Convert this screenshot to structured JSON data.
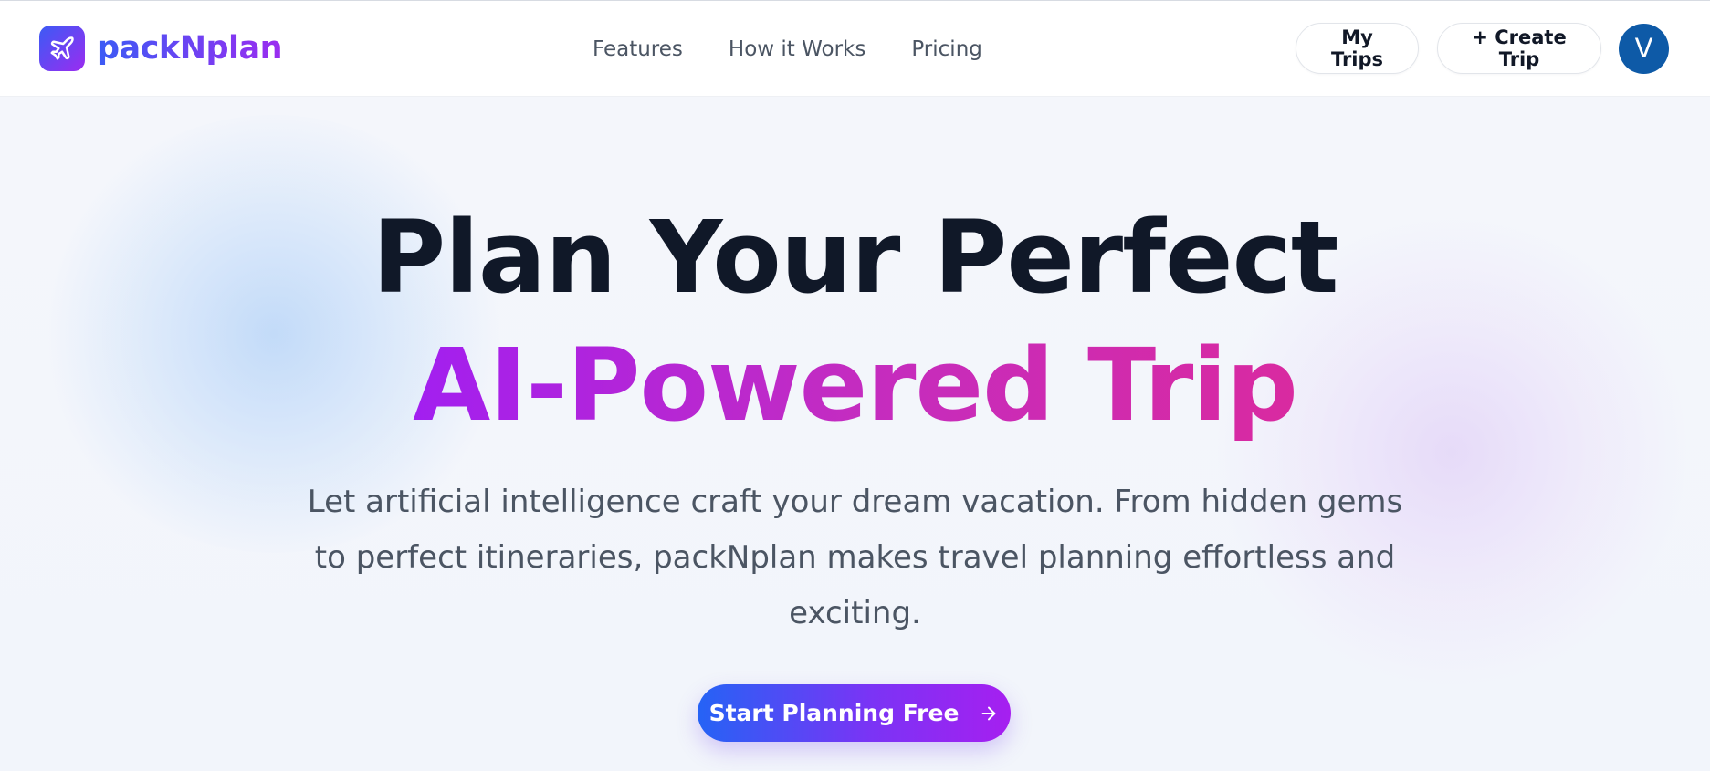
{
  "brand": {
    "name": "packNplan",
    "icon": "plane-icon"
  },
  "nav": {
    "items": [
      {
        "label": "Features"
      },
      {
        "label": "How it Works"
      },
      {
        "label": "Pricing"
      }
    ]
  },
  "header_actions": {
    "my_trips_label": "My Trips",
    "create_trip_label": "+ Create Trip",
    "avatar_initial": "V"
  },
  "hero": {
    "title": "Plan Your Perfect",
    "title_accent": "AI-Powered Trip",
    "subtitle": "Let artificial intelligence craft your dream vacation. From hidden gems to perfect itineraries, packNplan makes travel planning effortless and exciting.",
    "cta_label": "Start Planning Free",
    "cta_icon": "arrow-right-icon"
  },
  "colors": {
    "brand_gradient_start": "#3b5bf5",
    "brand_gradient_end": "#9b2cf0",
    "accent_gradient_start": "#a21ff0",
    "accent_gradient_end": "#d92aa0",
    "avatar_bg": "#0e5aa7",
    "title_text": "#101828",
    "body_text": "#4b5563"
  }
}
